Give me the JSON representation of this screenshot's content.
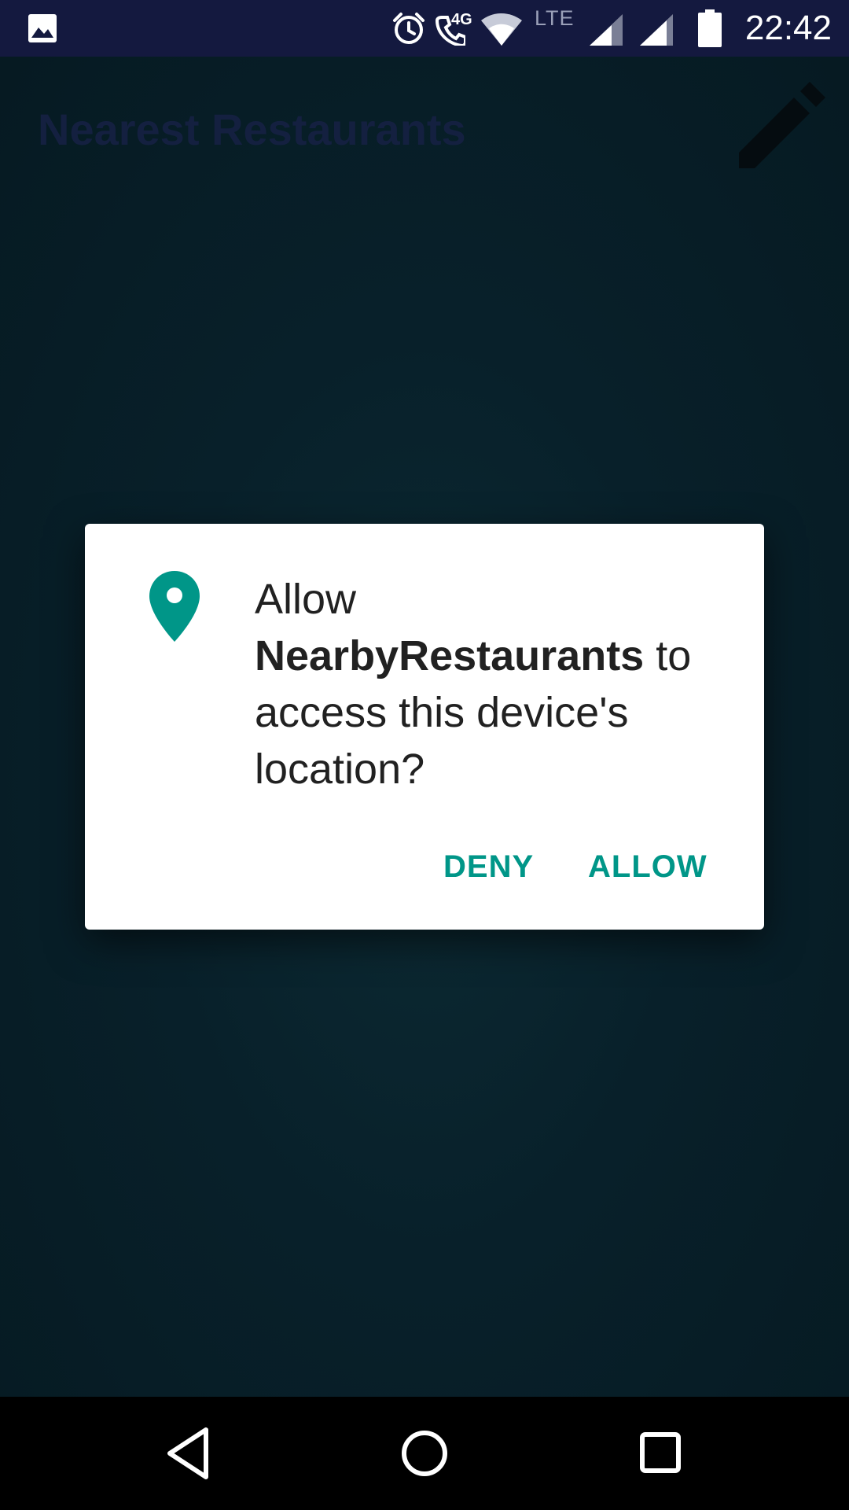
{
  "status_bar": {
    "time": "22:42",
    "network_4g": "4G",
    "network_lte": "LTE",
    "icons": [
      "image-icon",
      "alarm-icon",
      "call-icon",
      "wifi-icon",
      "signal-icon",
      "signal-icon",
      "battery-icon"
    ]
  },
  "app": {
    "title": "Nearest Restaurants",
    "action_icon": "edit-icon"
  },
  "dialog": {
    "icon": "location-pin-icon",
    "prefix": "Allow",
    "app_name": "NearbyRestaurants",
    "suffix": "to access this device's location?",
    "deny_label": "DENY",
    "allow_label": "ALLOW",
    "accent_color": "#009688"
  },
  "nav_bar": {
    "buttons": [
      "back-icon",
      "home-icon",
      "recents-icon"
    ]
  }
}
